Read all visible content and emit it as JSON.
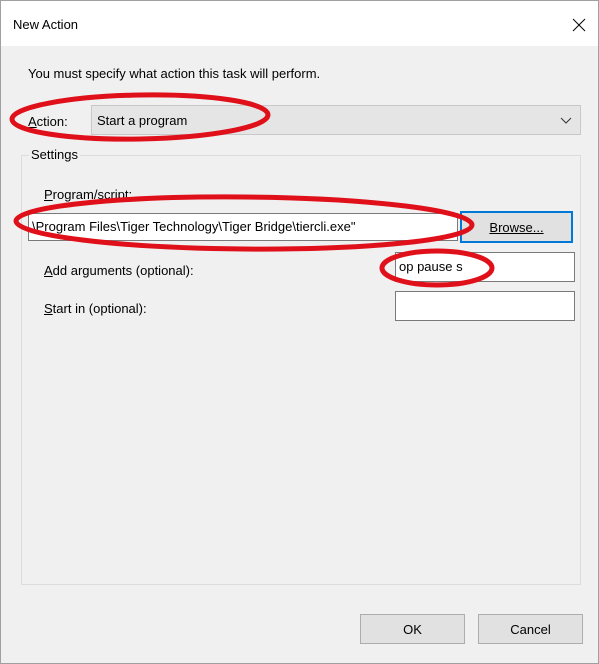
{
  "window": {
    "title": "New Action"
  },
  "dialog": {
    "instruction": "You must specify what action this task will perform.",
    "action_label_underlined": "A",
    "action_label_rest": "ction:",
    "action_value": "Start a program"
  },
  "settings": {
    "legend": "Settings",
    "program_label_underlined": "P",
    "program_label_rest": "rogram/script:",
    "program_value": "\\Program Files\\Tiger Technology\\Tiger Bridge\\tiercli.exe\"",
    "browse_label_underlined": "Browse...",
    "args_label_underlined": "A",
    "args_label_rest": "dd arguments (optional):",
    "args_value": "op pause s",
    "startin_label_underlined": "S",
    "startin_label_rest": "tart in (optional):",
    "startin_value": ""
  },
  "buttons": {
    "ok": "OK",
    "cancel": "Cancel"
  },
  "colors": {
    "annotation": "#e0101a",
    "focus": "#0078d7"
  }
}
